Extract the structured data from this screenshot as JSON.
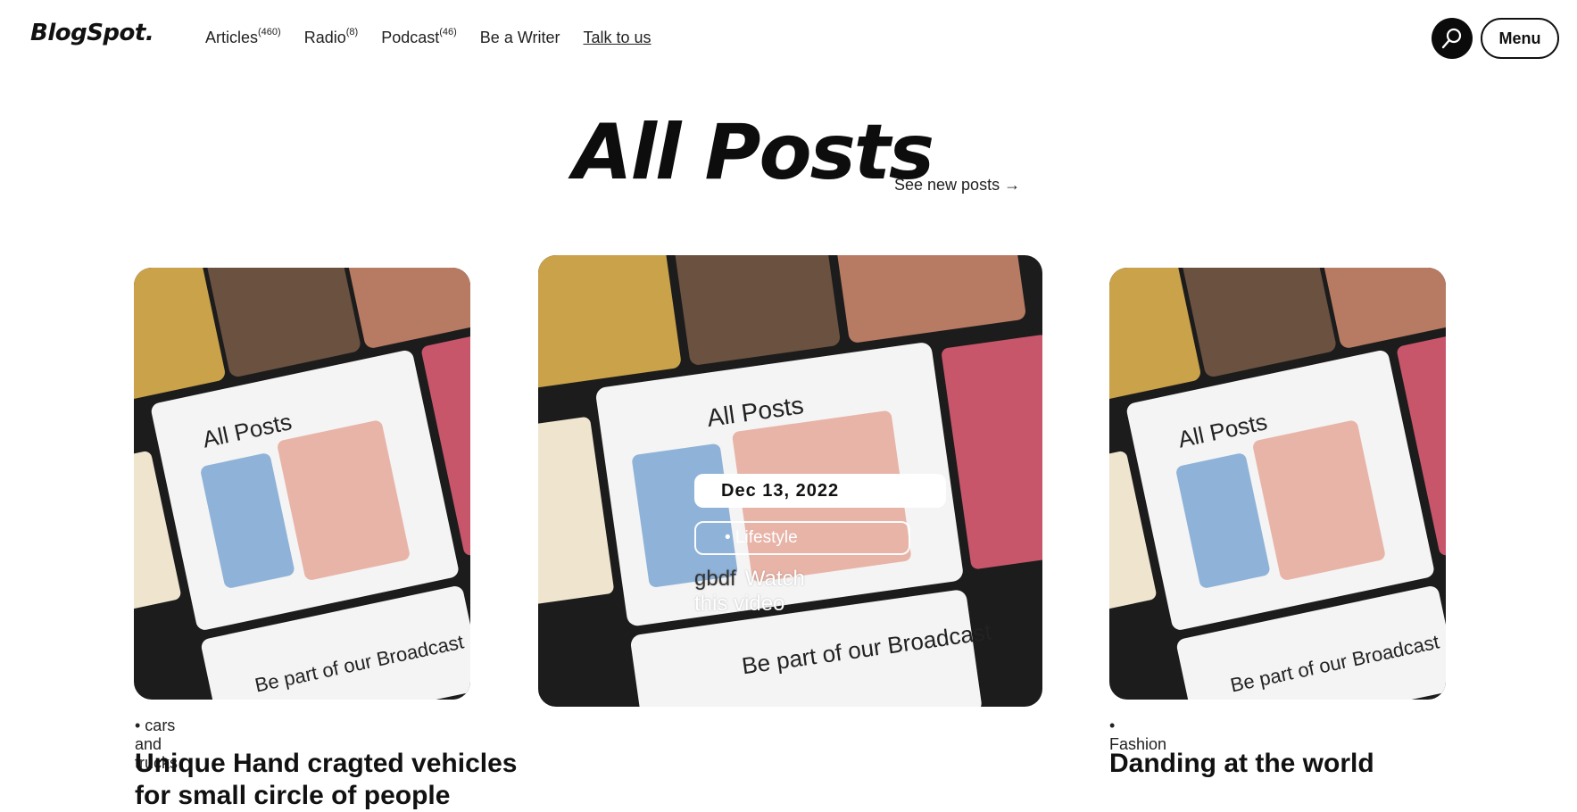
{
  "header": {
    "logo": "BlogSpot.",
    "nav": [
      {
        "label": "Articles",
        "count": "(460)"
      },
      {
        "label": "Radio",
        "count": "(8)"
      },
      {
        "label": "Podcast",
        "count": "(46)"
      },
      {
        "label": "Be a Writer",
        "count": ""
      },
      {
        "label": "Talk to us",
        "count": ""
      }
    ],
    "menu_label": "Menu"
  },
  "main": {
    "title": "All Posts",
    "see_new": "See new posts →"
  },
  "cards": [
    {
      "category": "• cars and trucks",
      "title": "Unique Hand cragted vehicles for small circle of people"
    },
    {
      "date": "Dec 13, 2022",
      "tag": "• Lifestyle",
      "prefix": "gbdf",
      "watch": "Watch this video"
    },
    {
      "category": "• Fashion",
      "title": "Danding at the world"
    }
  ],
  "colors": {
    "text": "#111111",
    "search_bg": "#0b0b0b"
  }
}
